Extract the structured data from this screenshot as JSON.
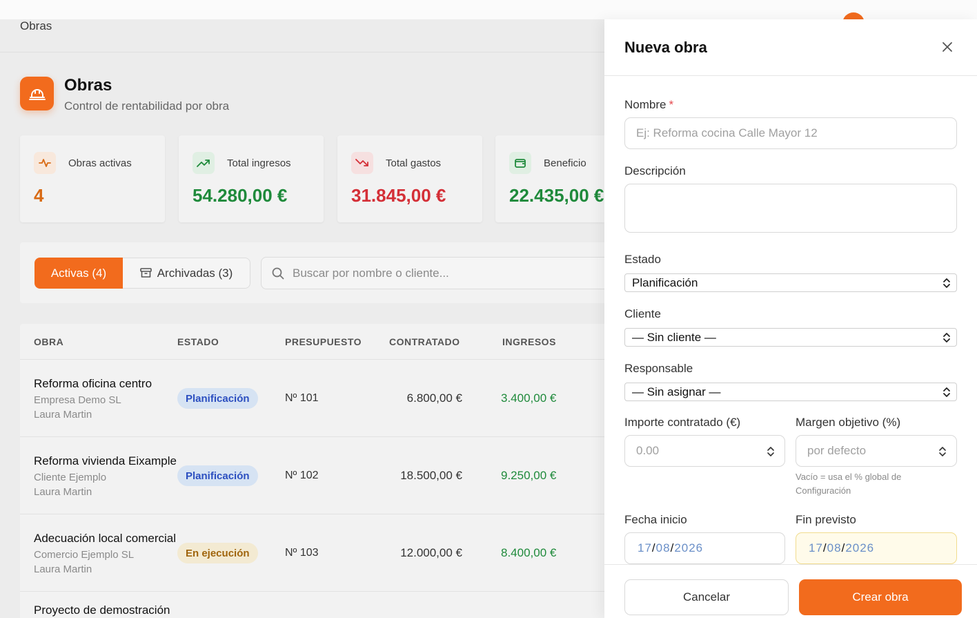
{
  "breadcrumb": "Obras",
  "page": {
    "title": "Obras",
    "subtitle": "Control de rentabilidad por obra",
    "icon": "helmet-icon"
  },
  "stats": [
    {
      "label": "Obras activas",
      "value": "4",
      "icon": "activity-icon",
      "color": "#d86a14"
    },
    {
      "label": "Total ingresos",
      "value": "54.280,00 €",
      "icon": "trending-up-icon",
      "color": "#1f8a3b"
    },
    {
      "label": "Total gastos",
      "value": "31.845,00 €",
      "icon": "trending-down-icon",
      "color": "#d42f37"
    },
    {
      "label": "Beneficio",
      "value": "22.435,00 €",
      "icon": "wallet-icon",
      "color": "#1f8a3b"
    }
  ],
  "tabs": {
    "active": "Activas (4)",
    "archived": "Archivadas (3)"
  },
  "search": {
    "placeholder": "Buscar por nombre o cliente..."
  },
  "table": {
    "columns": [
      "OBRA",
      "ESTADO",
      "PRESUPUESTO",
      "CONTRATADO",
      "INGRESOS"
    ],
    "rows": [
      {
        "title": "Reforma oficina centro",
        "client": "Empresa Demo SL",
        "responsible": "Laura Martin",
        "status": "Planificación",
        "budget": "Nº 101",
        "contracted": "6.800,00 €",
        "income": "3.400,00 €"
      },
      {
        "title": "Reforma vivienda Eixample",
        "client": "Cliente Ejemplo",
        "responsible": "Laura Martin",
        "status": "Planificación",
        "budget": "Nº 102",
        "contracted": "18.500,00 €",
        "income": "9.250,00 €"
      },
      {
        "title": "Adecuación local comercial",
        "client": "Comercio Ejemplo SL",
        "responsible": "Laura Martin",
        "status": "En ejecución",
        "budget": "Nº 103",
        "contracted": "12.000,00 €",
        "income": "8.400,00 €"
      },
      {
        "title": "Proyecto de demostración"
      }
    ]
  },
  "drawer": {
    "title": "Nueva obra",
    "fields": {
      "name_label": "Nombre",
      "name_required": "*",
      "name_placeholder": "Ej: Reforma cocina Calle Mayor 12",
      "description_label": "Descripción",
      "status_label": "Estado",
      "status_value": "Planificación",
      "client_label": "Cliente",
      "client_value": "— Sin cliente —",
      "responsible_label": "Responsable",
      "responsible_value": "— Sin asignar —",
      "amount_label": "Importe contratado (€)",
      "amount_placeholder": "0.00",
      "margin_label": "Margen objetivo (%)",
      "margin_placeholder": "por defecto",
      "margin_help": "Vacío = usa el % global de Configuración",
      "start_label": "Fecha inicio",
      "start_day": "17",
      "start_month": "08",
      "start_year": "2026",
      "end_label": "Fin previsto",
      "end_day": "17",
      "end_month": "08",
      "end_year": "2026"
    },
    "cancel_label": "Cancelar",
    "create_label": "Crear obra"
  },
  "colors": {
    "accent": "#f26b1d",
    "positive": "#1f8a3b",
    "negative": "#d42f37",
    "badge_plan": "#2c4fc0",
    "badge_exec": "#a0650d"
  }
}
